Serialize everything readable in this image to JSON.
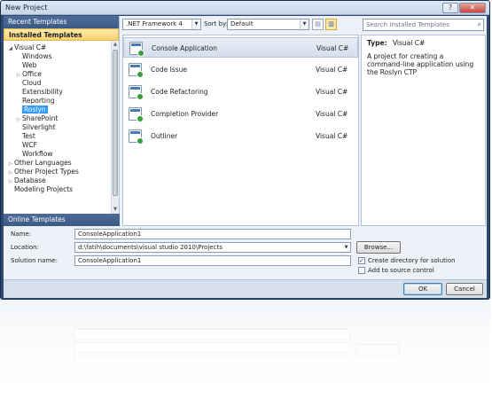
{
  "window": {
    "title": "New Project",
    "controls": [
      "minimize-icon",
      "close-icon"
    ],
    "accent": "#2e4a73"
  },
  "left_panel": {
    "recent_templates": "Recent Templates",
    "installed_templates": "Installed Templates",
    "online_templates": "Online Templates",
    "tree": [
      {
        "label": "Visual C#",
        "depth": 0,
        "expanded": true
      },
      {
        "label": "Windows",
        "depth": 1
      },
      {
        "label": "Web",
        "depth": 1
      },
      {
        "label": "Office",
        "depth": 1,
        "collapsed": true
      },
      {
        "label": "Cloud",
        "depth": 1
      },
      {
        "label": "Extensibility",
        "depth": 1
      },
      {
        "label": "Reporting",
        "depth": 1
      },
      {
        "label": "Roslyn",
        "depth": 1,
        "selected": true
      },
      {
        "label": "SharePoint",
        "depth": 1,
        "collapsed": true
      },
      {
        "label": "Silverlight",
        "depth": 1
      },
      {
        "label": "Test",
        "depth": 1
      },
      {
        "label": "WCF",
        "depth": 1
      },
      {
        "label": "Workflow",
        "depth": 1
      },
      {
        "label": "Other Languages",
        "depth": 0,
        "collapsed": true
      },
      {
        "label": "Other Project Types",
        "depth": 0,
        "collapsed": true
      },
      {
        "label": "Database",
        "depth": 0,
        "collapsed": true
      },
      {
        "label": "Modeling Projects",
        "depth": 0
      }
    ]
  },
  "toolbar": {
    "framework": ".NET Framework 4",
    "sort_label": "Sort by:",
    "sort_value": "Default"
  },
  "templates": [
    {
      "name": "Console Application",
      "lang": "Visual C#",
      "selected": true
    },
    {
      "name": "Code Issue",
      "lang": "Visual C#"
    },
    {
      "name": "Code Refactoring",
      "lang": "Visual C#"
    },
    {
      "name": "Completion Provider",
      "lang": "Visual C#"
    },
    {
      "name": "Outliner",
      "lang": "Visual C#"
    }
  ],
  "search": {
    "placeholder": "Search Installed Templates"
  },
  "description": {
    "type_label": "Type:",
    "type_value": "Visual C#",
    "text": "A project for creating a command-line application using the Roslyn CTP"
  },
  "form": {
    "name_label": "Name:",
    "name_value": "ConsoleApplication1",
    "location_label": "Location:",
    "location_value": "d:\\fatih\\documents\\visual studio 2010\\Projects",
    "solution_label": "Solution name:",
    "solution_value": "ConsoleApplication1",
    "browse": "Browse...",
    "create_dir": "Create directory for solution",
    "create_dir_checked": true,
    "add_source": "Add to source control",
    "add_source_checked": false,
    "ok": "OK",
    "cancel": "Cancel"
  }
}
